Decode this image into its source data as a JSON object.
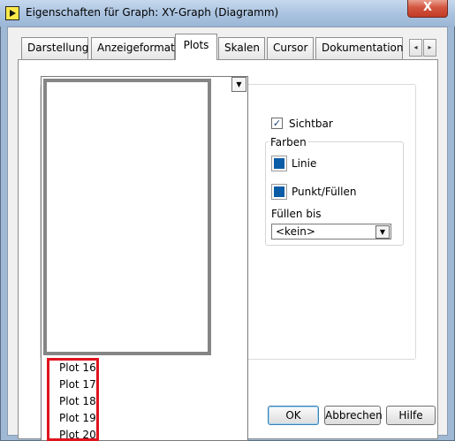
{
  "window": {
    "title": "Eigenschaften für Graph: XY-Graph (Diagramm)",
    "close_label": "X"
  },
  "tabs": [
    "Darstellung",
    "Anzeigeformat",
    "Plots",
    "Skalen",
    "Cursor",
    "Dokumentation"
  ],
  "active_tab": "Plots",
  "tab_scroll": {
    "left": "◂",
    "right": "▸"
  },
  "plot_dropdown": {
    "arrow": "▼",
    "visible_items": [
      "Plot 16",
      "Plot 17",
      "Plot 18",
      "Plot 19",
      "Plot 20"
    ]
  },
  "plot_settings": {
    "visible_label": "Sichtbar",
    "visible_checked": true,
    "colors_group": "Farben",
    "line_label": "Linie",
    "point_fill_label": "Punkt/Füllen",
    "color_value": "#0a5ca6",
    "fill_to_label": "Füllen bis",
    "fill_to_value": "<kein>"
  },
  "buttons": {
    "ok": "OK",
    "cancel": "Abbrechen",
    "help": "Hilfe"
  },
  "annotation": {
    "highlight_color": "#e0141e"
  }
}
